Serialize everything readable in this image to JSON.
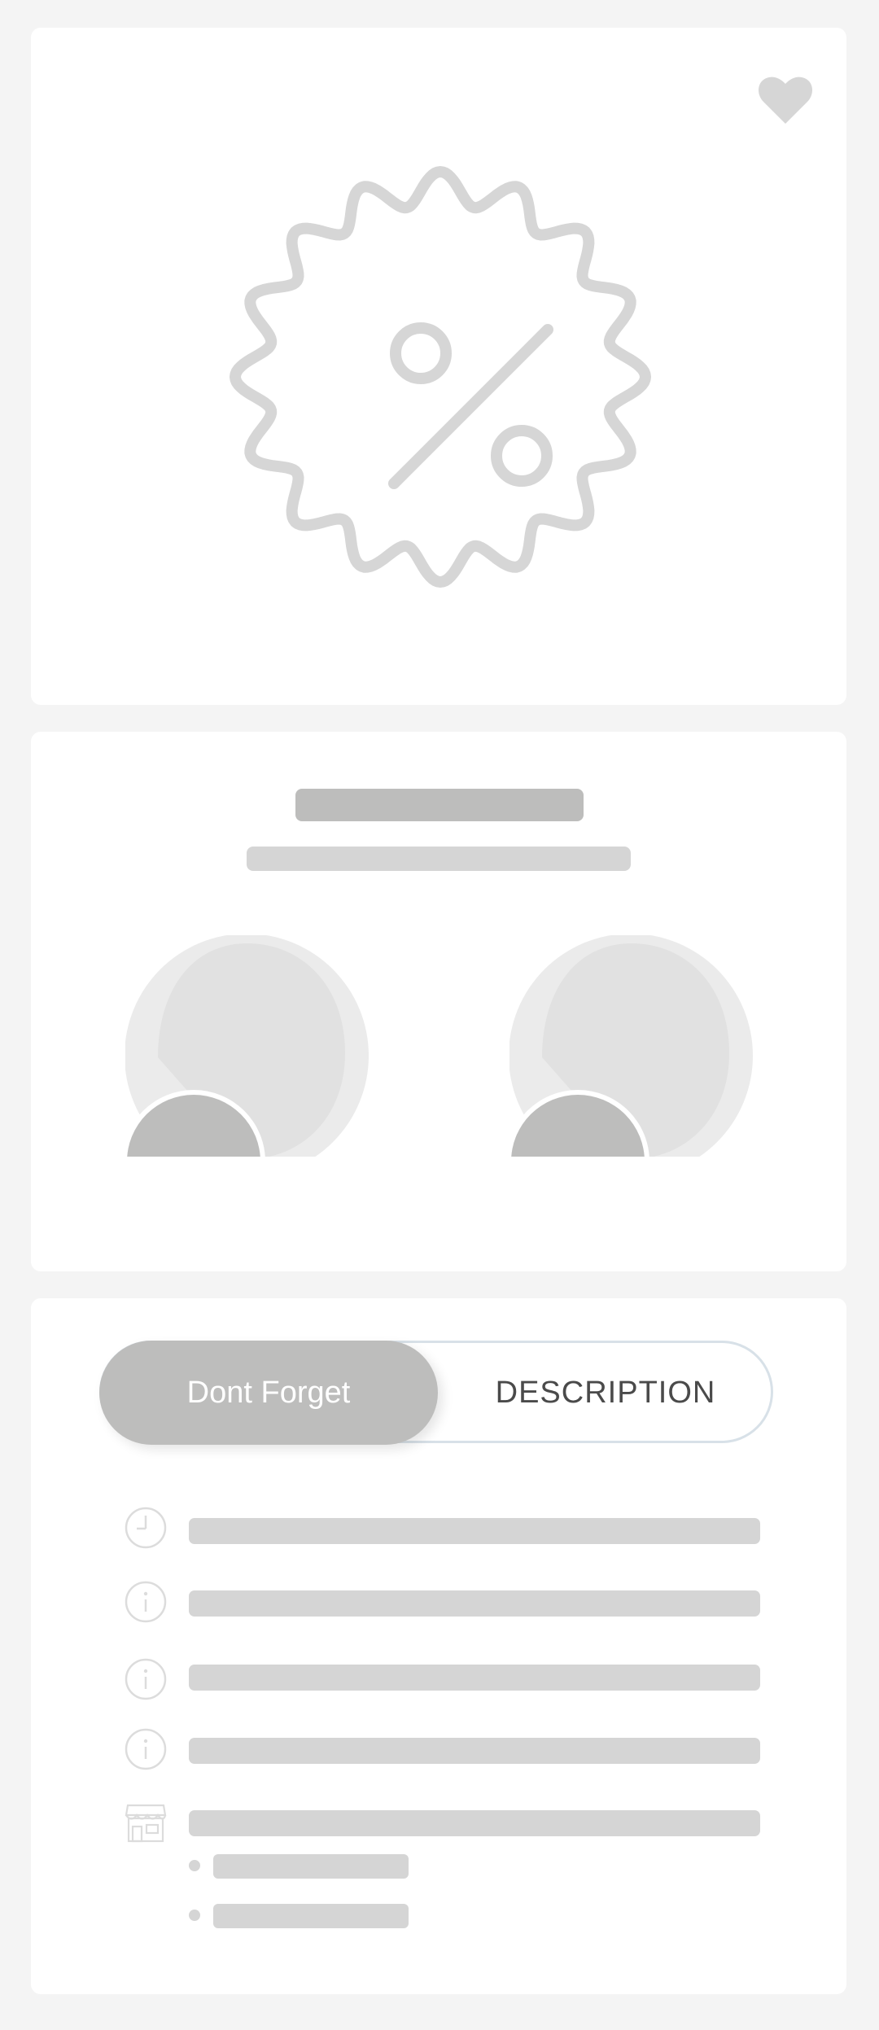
{
  "favorite_icon": "heart-icon",
  "hero": {
    "icon": "discount-badge-icon"
  },
  "info": {
    "avatars": [
      "avatar-pair-left",
      "avatar-pair-right"
    ]
  },
  "tabs": {
    "active_label": "Dont Forget",
    "inactive_label": "DESCRIPTION"
  },
  "detail_rows": [
    {
      "icon": "clock-icon"
    },
    {
      "icon": "info-icon"
    },
    {
      "icon": "info-icon"
    },
    {
      "icon": "info-icon"
    },
    {
      "icon": "store-icon"
    }
  ],
  "colors": {
    "background": "#f4f4f4",
    "card": "#ffffff",
    "skeleton": "#d5d5d5",
    "skeleton_dark": "#bdbdbc",
    "icon_gray": "#d6d6d6"
  }
}
